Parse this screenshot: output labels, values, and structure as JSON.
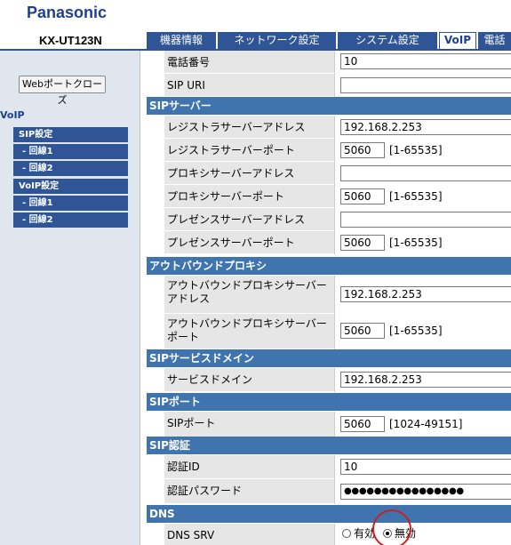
{
  "header": {
    "brand": "Panasonic",
    "model": "KX-UT123N"
  },
  "tabs": [
    {
      "label": "機器情報",
      "active": false
    },
    {
      "label": "ネットワーク設定",
      "active": false
    },
    {
      "label": "システム設定",
      "active": false
    },
    {
      "label": "VoIP",
      "active": true
    },
    {
      "label": "電話",
      "active": false
    }
  ],
  "sidebar": {
    "web_close_button": "Webポートクローズ",
    "section_title": "VoIP",
    "menu": [
      {
        "label": "SIP設定"
      },
      {
        "label": "- 回線1"
      },
      {
        "label": "- 回線2"
      },
      {
        "label": "VoIP設定"
      },
      {
        "label": "- 回線1"
      },
      {
        "label": "- 回線2"
      }
    ]
  },
  "form": {
    "phone_number": {
      "label": "電話番号",
      "value": "10"
    },
    "sip_uri": {
      "label": "SIP URI",
      "value": ""
    },
    "sip_server": {
      "section": "SIPサーバー",
      "registrar_address": {
        "label": "レジストラサーバーアドレス",
        "value": "192.168.2.253"
      },
      "registrar_port": {
        "label": "レジストラサーバーポート",
        "value": "5060",
        "range": "[1-65535]"
      },
      "proxy_address": {
        "label": "プロキシサーバーアドレス",
        "value": ""
      },
      "proxy_port": {
        "label": "プロキシサーバーポート",
        "value": "5060",
        "range": "[1-65535]"
      },
      "presence_address": {
        "label": "プレゼンスサーバーアドレス",
        "value": ""
      },
      "presence_port": {
        "label": "プレゼンスサーバーポート",
        "value": "5060",
        "range": "[1-65535]"
      }
    },
    "outbound_proxy": {
      "section": "アウトバウンドプロキシ",
      "address": {
        "label_line1": "アウトバウンドプロキシサーバー",
        "label_line2": "アドレス",
        "value": "192.168.2.253"
      },
      "port": {
        "label_line1": "アウトバウンドプロキシサーバー",
        "label_line2": "ポート",
        "value": "5060",
        "range": "[1-65535]"
      }
    },
    "service_domain": {
      "section": "SIPサービスドメイン",
      "domain": {
        "label": "サービスドメイン",
        "value": "192.168.2.253"
      }
    },
    "sip_port": {
      "section": "SIPポート",
      "port": {
        "label": "SIPポート",
        "value": "5060",
        "range": "[1024-49151]"
      }
    },
    "sip_auth": {
      "section": "SIP認証",
      "auth_id": {
        "label": "認証ID",
        "value": "10"
      },
      "auth_password": {
        "label": "認証パスワード",
        "value": "●●●●●●●●●●●●●●●●"
      }
    },
    "dns": {
      "section": "DNS",
      "dns_srv": {
        "label": "DNS SRV",
        "option_on": "有効",
        "option_off": "無効",
        "selected": "無効"
      }
    }
  },
  "colors": {
    "brand": "#1f3f8f",
    "tab": "#2f5597",
    "section": "#3f74ae",
    "label_bg": "#e6e6e6",
    "sidebar_bg": "#dfe6ee",
    "highlight": "#cc1f1f"
  }
}
